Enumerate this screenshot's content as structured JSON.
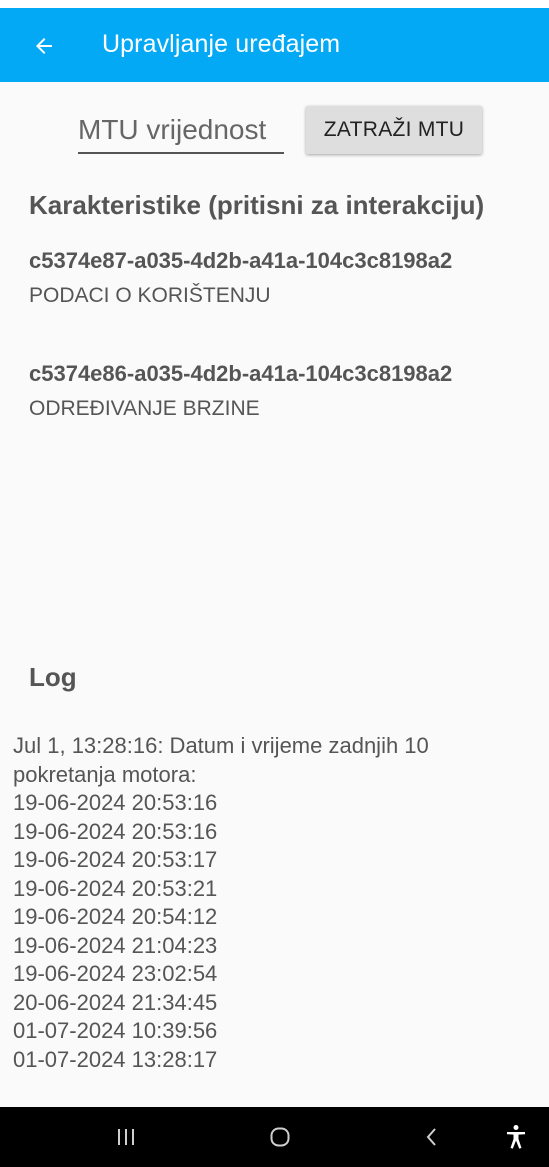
{
  "app_bar": {
    "title": "Upravljanje uređajem",
    "background": "#03a9f4",
    "back_icon": "arrow-back-icon"
  },
  "mtu": {
    "placeholder": "MTU vrijednost",
    "button_label": "ZATRAŽI MTU"
  },
  "characteristics": {
    "title": "Karakteristike (pritisni za interakciju)",
    "items": [
      {
        "uuid": "c5374e87-a035-4d2b-a41a-104c3c8198a2",
        "name": "PODACI O KORIŠTENJU"
      },
      {
        "uuid": "c5374e86-a035-4d2b-a41a-104c3c8198a2",
        "name": "ODREĐIVANJE BRZINE"
      }
    ]
  },
  "log": {
    "title": "Log",
    "lines": [
      "Jul 1, 13:28:16: Datum i vrijeme zadnjih 10",
      "pokretanja motora:",
      "19-06-2024 20:53:16",
      "19-06-2024 20:53:16",
      "19-06-2024 20:53:17",
      "19-06-2024 20:53:21",
      "19-06-2024 20:54:12",
      "19-06-2024 21:04:23",
      "19-06-2024 23:02:54",
      "20-06-2024 21:34:45",
      "01-07-2024 10:39:56",
      "01-07-2024 13:28:17"
    ]
  },
  "nav_bar": {
    "buttons": [
      "recents-icon",
      "home-icon",
      "back-icon",
      "accessibility-icon"
    ]
  }
}
